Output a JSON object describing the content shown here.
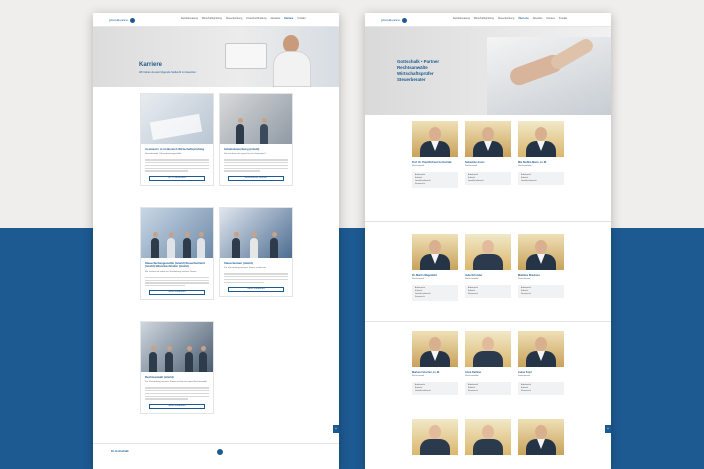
{
  "nav": {
    "logo_text": "gottschalk-partner",
    "links": [
      "Rechtsberatung",
      "Wirtschaftsprüfung",
      "Steuerberatung",
      "Finanzbuchhaltung",
      "Aktuelles",
      "Karriere",
      "Kontakt"
    ],
    "links_p2": [
      "Rechtsberatung",
      "Wirtschaftsprüfung",
      "Steuerberatung",
      "Über uns",
      "Aktuelles",
      "Karriere",
      "Kontakt"
    ]
  },
  "career": {
    "title": "Karriere",
    "subtitle": "Wir haben da weit folgende Stellenbl zu besetzen:",
    "cards": [
      {
        "title": "Assistent / in im Bereich Wirtschaftsprüfung",
        "sub": "Steuerberater / Steuerfachangestellte",
        "button": "JETZT BEWERBEN"
      },
      {
        "title": "Initiativbewerbung (m/w/d)",
        "sub": "Sie möchten sich gerne bei uns bewerben?",
        "button": "BEWERBUNG SENDEN"
      },
      {
        "title": "Steuerfachangestellte (m/w/d) Steuerfachwirt (m/w/d) Bilanzbuchhalter (m/w/d)",
        "sub": "Wir suchen ab sofort zur Verstärkung unseres Teams",
        "button": "MEHR ERFAHREN"
      },
      {
        "title": "Steuerberater (m/w/d)",
        "sub": "Zur Verstärkung unseres Teams suchen wir",
        "button": "MEHR ERFAHREN"
      },
      {
        "title": "Rechtsanwalt (m/w/d)",
        "sub": "Zur Verstärkung unseres Teams suchen wir einen Rechtsanwalt",
        "button": "MEHR ERFAHREN"
      }
    ]
  },
  "footer": {
    "logo": "Dr. Gottschalk"
  },
  "team": {
    "hero_lines": [
      "Gottschalk • Partner",
      "Rechtsanwälte",
      "Wirtschaftsprüfer",
      "Steuerberater"
    ],
    "members": [
      {
        "name": "Prof. Dr. Paul-Richard Gottschalk",
        "role": "Rechtsanwalt"
      },
      {
        "name": "Sebastian Arens",
        "role": "Rechtsanwalt"
      },
      {
        "name": "Mia Steffen-Maris, LL.M.",
        "role": "Rechtsanwältin"
      },
      {
        "name": "Dr. Martin Wagenfeld",
        "role": "Rechtsanwalt"
      },
      {
        "name": "Julia Schröder",
        "role": "Rechtsanwältin"
      },
      {
        "name": "Matthias Brückner",
        "role": "Steuerberater"
      },
      {
        "name": "Markus Fetscher, LL.M.",
        "role": "Rechtsanwalt"
      },
      {
        "name": "Anna Kathner",
        "role": "Rechtsanwältin"
      },
      {
        "name": "Lukas Kopf",
        "role": "Steuerberater"
      }
    ],
    "box_items": [
      "Arbeitsrecht",
      "Erbrecht",
      "Gesellschaftsrecht",
      "Steuerrecht"
    ]
  }
}
